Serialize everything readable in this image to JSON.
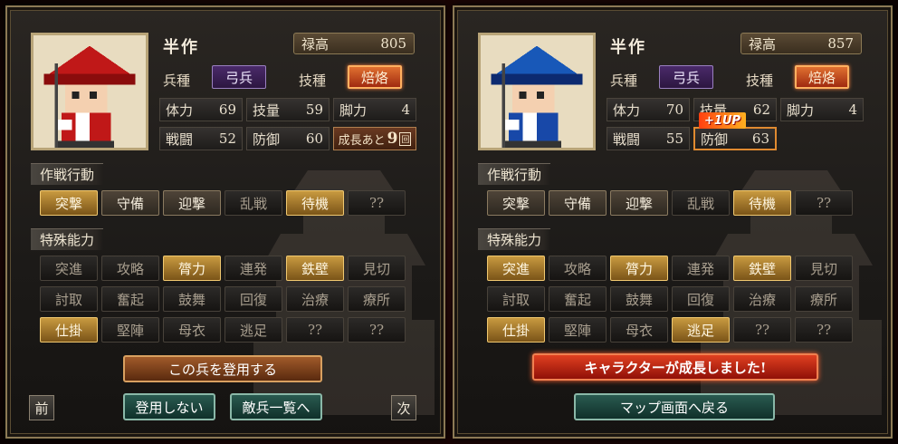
{
  "left": {
    "name": "半作",
    "stipend_label": "禄高",
    "stipend_value": "805",
    "class_label": "兵種",
    "class_value": "弓兵",
    "skill_label": "技種",
    "skill_value": "焙烙",
    "stats": {
      "hp": {
        "label": "体力",
        "value": "69"
      },
      "tech": {
        "label": "技量",
        "value": "59"
      },
      "legs": {
        "label": "脚力",
        "value": "4"
      },
      "atk": {
        "label": "戦闘",
        "value": "52"
      },
      "def": {
        "label": "防御",
        "value": "60"
      }
    },
    "growth": {
      "label": "成長あと",
      "value": "9",
      "unit": "回"
    },
    "tactics_title": "作戦行動",
    "tactics": [
      "突撃",
      "守備",
      "迎撃",
      "乱戦",
      "待機",
      "??"
    ],
    "abilities_title": "特殊能力",
    "abilities": [
      "突進",
      "攻略",
      "膂力",
      "連発",
      "鉄壁",
      "見切",
      "討取",
      "奮起",
      "鼓舞",
      "回復",
      "治療",
      "療所",
      "仕掛",
      "堅陣",
      "母衣",
      "逃足",
      "??",
      "??"
    ],
    "recruit_button": "この兵を登用する",
    "decline_button": "登用しない",
    "enemy_list_button": "敵兵一覧へ",
    "prev_button": "前",
    "next_button": "次",
    "hat_color": "#c01818",
    "body_color": "#c01818"
  },
  "right": {
    "name": "半作",
    "stipend_label": "禄高",
    "stipend_value": "857",
    "class_label": "兵種",
    "class_value": "弓兵",
    "skill_label": "技種",
    "skill_value": "焙烙",
    "stats": {
      "hp": {
        "label": "体力",
        "value": "70"
      },
      "tech": {
        "label": "技量",
        "value": "62"
      },
      "legs": {
        "label": "脚力",
        "value": "4"
      },
      "atk": {
        "label": "戦闘",
        "value": "55"
      },
      "def": {
        "label": "防御",
        "value": "63"
      }
    },
    "oneup_label": "+1UP",
    "tactics_title": "作戦行動",
    "tactics": [
      "突撃",
      "守備",
      "迎撃",
      "乱戦",
      "待機",
      "??"
    ],
    "abilities_title": "特殊能力",
    "abilities": [
      "突進",
      "攻略",
      "膂力",
      "連発",
      "鉄壁",
      "見切",
      "討取",
      "奮起",
      "鼓舞",
      "回復",
      "治療",
      "療所",
      "仕掛",
      "堅陣",
      "母衣",
      "逃足",
      "??",
      "??"
    ],
    "grew_banner": "キャラクターが成長しました!",
    "map_button": "マップ画面へ戻る",
    "hat_color": "#1858b8",
    "body_color": "#1848a8"
  }
}
